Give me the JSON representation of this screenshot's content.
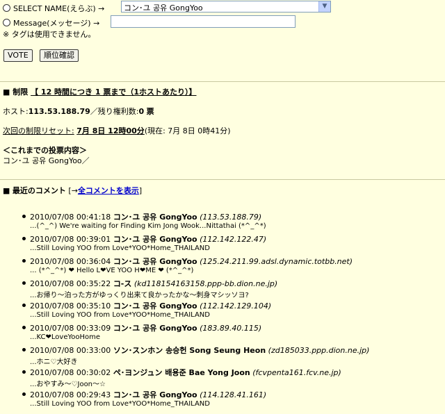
{
  "form": {
    "select_label": "SELECT NAME(えらぶ) →",
    "select_value": "コン･ユ  공유  GongYoo",
    "message_label": "Message(メッセージ) →",
    "message_value": "",
    "tag_note": "※ タグは使用できません。",
    "vote_button": "VOTE",
    "rank_button": "順位確認"
  },
  "limit": {
    "marker": "■",
    "label": "制限",
    "rule": "【 12 時間につき 1 票まで（1ホストあたり）】",
    "host_label": "ホスト:",
    "host_value": "113.53.188.79",
    "remaining_label": "／残り権利数:",
    "remaining_value": "0",
    "remaining_unit": "票",
    "reset_label": "次回の制限リセット:",
    "reset_value": "7月 8日 12時00分",
    "now_text": "(現在: 7月 8日 0時41分)"
  },
  "history": {
    "title": "＜これまでの投票内容＞",
    "content": "コン･ユ  공유  GongYoo／"
  },
  "recent": {
    "marker": "■",
    "title": "最近のコメント",
    "bracket_open": "[→",
    "show_all_link": "全コメントを表示",
    "bracket_close": "]"
  },
  "comments": [
    {
      "time": "2010/07/08 00:41:18",
      "name": "コン･ユ  공유  GongYoo",
      "host": "(113.53.188.79)",
      "message": "...(^_^) We're waiting for Finding Kim Jong Wook...Nittathai (*^_^*)"
    },
    {
      "time": "2010/07/08 00:39:01",
      "name": "コン･ユ  공유  GongYoo",
      "host": "(112.142.122.47)",
      "message": "...Still Loving YOO from Love*YOO*Home_THAILAND"
    },
    {
      "time": "2010/07/08 00:36:04",
      "name": "コン･ユ  공유  GongYoo",
      "host": "(125.24.211.99.adsl.dynamic.totbb.net)",
      "message": "... (*^_^*) ❤ Hello L❤VE YOO H❤ME ❤ (*^_^*)"
    },
    {
      "time": "2010/07/08 00:35:22",
      "name": "コ-ス",
      "host": "(kd118154163158.ppp-bb.dion.ne.jp)",
      "message": "...お帰り～泊った方がゆっくり出来て良かったかな～刺身マシッソヨ?"
    },
    {
      "time": "2010/07/08 00:35:10",
      "name": "コン･ユ  공유  GongYoo",
      "host": "(112.142.129.104)",
      "message": "...Still Loving YOO from Love*YOO*Home_THAILAND"
    },
    {
      "time": "2010/07/08 00:33:09",
      "name": "コン･ユ  공유  GongYoo",
      "host": "(183.89.40.115)",
      "message": "...KC❤LoveYooHome"
    },
    {
      "time": "2010/07/08 00:33:00",
      "name": "ソン･スンホン  송승헌  Song Seung Heon",
      "host": "(zd185033.ppp.dion.ne.jp)",
      "message": "...ホニ♡大好き"
    },
    {
      "time": "2010/07/08 00:30:02",
      "name": "ペ･ヨンジュン  배용준  Bae Yong Joon",
      "host": "(fcvpenta161.fcv.ne.jp)",
      "message": "...おやすみ～♡Joon～☆"
    },
    {
      "time": "2010/07/08 00:29:43",
      "name": "コン･ユ  공유  GongYoo",
      "host": "(114.128.41.161)",
      "message": "...Still Loving YOO from Love*YOO*Home_THAILAND"
    }
  ]
}
